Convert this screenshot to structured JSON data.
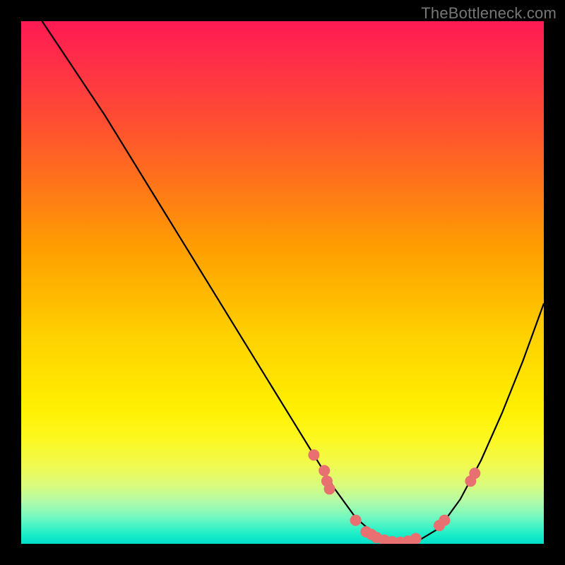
{
  "watermark": "TheBottleneck.com",
  "chart_data": {
    "type": "line",
    "title": "",
    "xlabel": "",
    "ylabel": "",
    "xlim": [
      0,
      100
    ],
    "ylim": [
      0,
      100
    ],
    "curve": {
      "x": [
        4,
        8,
        12,
        16,
        20,
        24,
        28,
        32,
        36,
        40,
        44,
        48,
        52,
        56,
        60,
        64,
        68,
        72,
        76,
        80,
        84,
        88,
        92,
        96,
        100
      ],
      "y": [
        100,
        94,
        88,
        82,
        75.5,
        69,
        62.5,
        56,
        49.5,
        43,
        36.5,
        30,
        23.5,
        17,
        10.5,
        5,
        1.5,
        0.3,
        0.6,
        3,
        8.5,
        16,
        25,
        35,
        46
      ]
    },
    "points": [
      {
        "x": 56,
        "y": 17
      },
      {
        "x": 58,
        "y": 14
      },
      {
        "x": 58.5,
        "y": 12
      },
      {
        "x": 59,
        "y": 10.5
      },
      {
        "x": 64,
        "y": 4.5
      },
      {
        "x": 66,
        "y": 2.3
      },
      {
        "x": 67,
        "y": 1.8
      },
      {
        "x": 68,
        "y": 1.2
      },
      {
        "x": 69.5,
        "y": 0.7
      },
      {
        "x": 71,
        "y": 0.4
      },
      {
        "x": 72.5,
        "y": 0.3
      },
      {
        "x": 74,
        "y": 0.5
      },
      {
        "x": 75.5,
        "y": 1.0
      },
      {
        "x": 80,
        "y": 3.5
      },
      {
        "x": 81,
        "y": 4.5
      },
      {
        "x": 86,
        "y": 12
      },
      {
        "x": 86.8,
        "y": 13.5
      }
    ],
    "gradient_stops": [
      {
        "pos": 0,
        "color": "#ff1a55"
      },
      {
        "pos": 50,
        "color": "#ffc000"
      },
      {
        "pos": 85,
        "color": "#f0fa50"
      },
      {
        "pos": 100,
        "color": "#00e0c8"
      }
    ]
  }
}
